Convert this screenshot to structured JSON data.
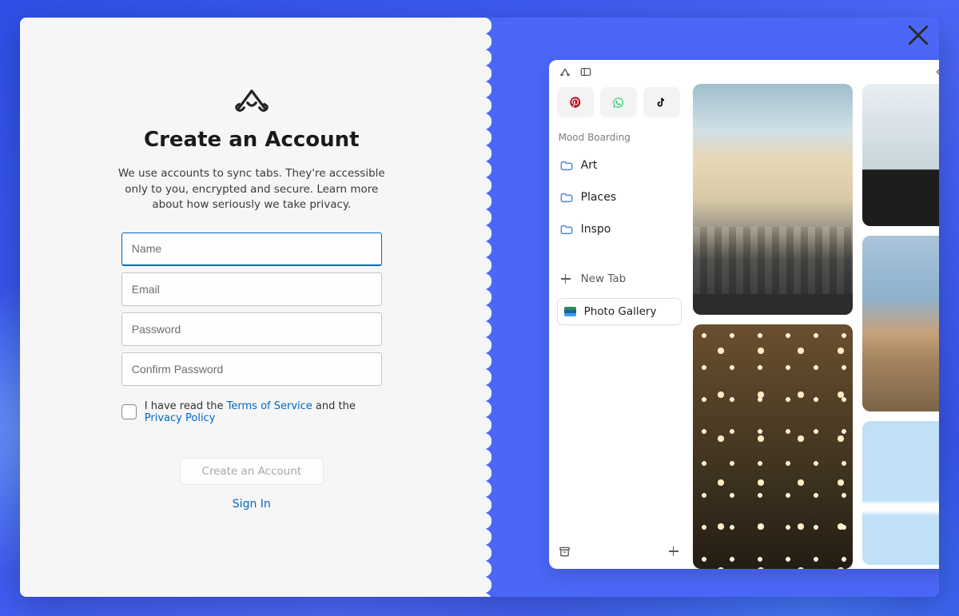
{
  "account": {
    "title": "Create an Account",
    "description": "We use accounts to sync tabs. They're accessible only to you, encrypted and secure. Learn more about how seriously we take privacy.",
    "fields": {
      "name_placeholder": "Name",
      "email_placeholder": "Email",
      "password_placeholder": "Password",
      "confirm_placeholder": "Confirm Password"
    },
    "terms": {
      "prefix": "I have read the ",
      "tos": "Terms of Service",
      "middle": " and the ",
      "privacy": "Privacy Policy"
    },
    "create_button": "Create an Account",
    "signin": "Sign In"
  },
  "preview": {
    "section_label": "Mood Boarding",
    "folders": [
      "Art",
      "Places",
      "Inspo"
    ],
    "new_tab": "New Tab",
    "active_tab": "Photo Gallery"
  }
}
